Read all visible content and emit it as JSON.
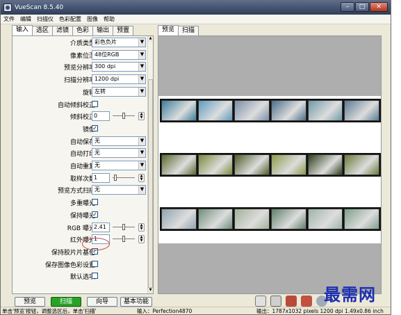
{
  "window": {
    "title": "VueScan 8.5.40"
  },
  "menu": [
    "文件",
    "编辑",
    "扫描仪",
    "色彩配置",
    "图像",
    "帮助"
  ],
  "left_tabs": [
    "输入",
    "选区",
    "滤镜",
    "色彩",
    "输出",
    "预置"
  ],
  "right_tabs": [
    "预览",
    "扫描"
  ],
  "settings": [
    {
      "label": "介质类型:",
      "type": "select",
      "value": "彩色负片"
    },
    {
      "label": "像素位深:",
      "type": "select",
      "value": "48位RGB"
    },
    {
      "label": "预览分辨率:",
      "type": "select",
      "value": "300 dpi"
    },
    {
      "label": "扫描分辨率:",
      "type": "select",
      "value": "1200 dpi"
    },
    {
      "label": "旋转:",
      "type": "select",
      "value": "左转"
    },
    {
      "label": "自动倾斜校正:",
      "type": "checkbox",
      "checked": false
    },
    {
      "label": "倾斜校正:",
      "type": "number",
      "value": "0"
    },
    {
      "label": "镜像:",
      "type": "checkbox",
      "checked": true
    },
    {
      "label": "自动保存:",
      "type": "select",
      "value": "无"
    },
    {
      "label": "自动打印:",
      "type": "select",
      "value": "无"
    },
    {
      "label": "自动重复:",
      "type": "select",
      "value": "无"
    },
    {
      "label": "取样次数:",
      "type": "number",
      "value": "1"
    },
    {
      "label": "预览方式扫描:",
      "type": "select",
      "value": "无"
    },
    {
      "label": "多重曝光:",
      "type": "checkbox",
      "checked": false
    },
    {
      "label": "保持曝光:",
      "type": "checkbox",
      "checked": true
    },
    {
      "label": "RGB 曝光:",
      "type": "number",
      "value": "2.41"
    },
    {
      "label": "红外曝光:",
      "type": "number",
      "value": "1"
    },
    {
      "label": "保持胶片片基色:",
      "type": "checkbox",
      "checked": true
    },
    {
      "label": "保存图像色彩设置:",
      "type": "checkbox",
      "checked": false
    },
    {
      "label": "默认选项:",
      "type": "checkbox",
      "checked": false
    }
  ],
  "buttons": {
    "preview": "预览",
    "scan": "扫描",
    "wizard": "向导",
    "basic": "基本功能"
  },
  "status": {
    "hint": "单击'预览'按钮，调整选区后，单击'扫描'",
    "input": "输入：Perfection4870",
    "output": "输出：1787x1032 pixels 1200 dpi 1.49x0.86 inch"
  },
  "watermark": "最需网",
  "colors": {
    "scan_button": "#27a327",
    "annotation": "#c8474a",
    "watermark": "#1c2fb0"
  },
  "icons": [
    "save-icon",
    "print-icon",
    "zoom-icon"
  ]
}
